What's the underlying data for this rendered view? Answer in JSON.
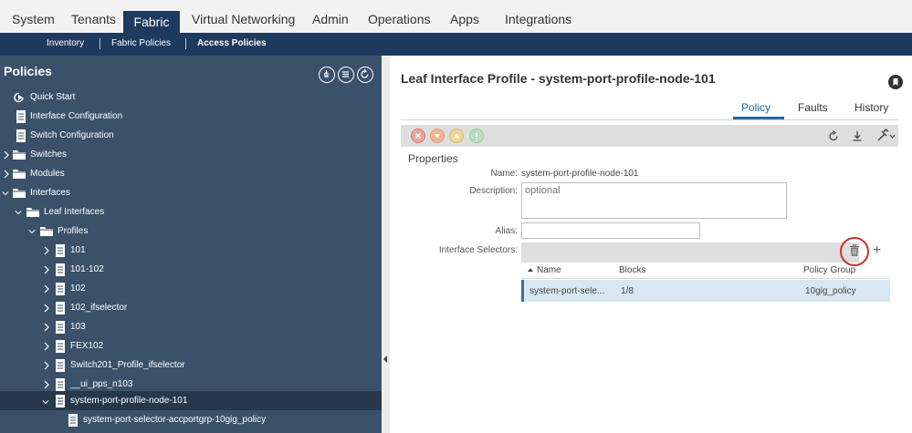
{
  "top_nav": {
    "tabs": [
      {
        "label": "System"
      },
      {
        "label": "Tenants"
      },
      {
        "label": "Fabric"
      },
      {
        "label": "Virtual Networking"
      },
      {
        "label": "Admin"
      },
      {
        "label": "Operations"
      },
      {
        "label": "Apps"
      },
      {
        "label": "Integrations"
      }
    ],
    "active_tab": "Fabric",
    "sub_items": [
      {
        "label": "Inventory"
      },
      {
        "label": "Fabric Policies"
      },
      {
        "label": "Access Policies"
      }
    ]
  },
  "sidebar": {
    "title": "Policies",
    "header_buttons": [
      "settings-icon",
      "list-icon",
      "refresh-icon"
    ],
    "tree": [
      {
        "label": "Quick Start",
        "icon": "quickstart-icon"
      },
      {
        "label": "Interface Configuration",
        "icon": "document-icon"
      },
      {
        "label": "Switch Configuration",
        "icon": "document-icon"
      },
      {
        "label": "Switches",
        "icon": "folder-icon"
      },
      {
        "label": "Modules",
        "icon": "folder-icon"
      },
      {
        "label": "Interfaces",
        "icon": "folder-icon"
      },
      {
        "label": "Leaf Interfaces",
        "icon": "folder-icon"
      },
      {
        "label": "Profiles",
        "icon": "folder-icon"
      },
      {
        "label": "101",
        "icon": "document-icon"
      },
      {
        "label": "101-102",
        "icon": "document-icon"
      },
      {
        "label": "102",
        "icon": "document-icon"
      },
      {
        "label": "102_ifselector",
        "icon": "document-icon"
      },
      {
        "label": "103",
        "icon": "document-icon"
      },
      {
        "label": "FEX102",
        "icon": "document-icon"
      },
      {
        "label": "Switch201_Profile_ifselector",
        "icon": "document-icon"
      },
      {
        "label": "__ui_pps_n103",
        "icon": "document-icon"
      },
      {
        "label": "system-port-profile-node-101",
        "icon": "document-icon"
      },
      {
        "label": "system-port-selector-accportgrp-10gig_policy",
        "icon": "document-icon"
      }
    ]
  },
  "main": {
    "title": "Leaf Interface Profile - system-port-profile-node-101",
    "tabs": [
      {
        "label": "Policy"
      },
      {
        "label": "Faults"
      },
      {
        "label": "History"
      }
    ],
    "active_tab": "Policy",
    "toolbar": {
      "fault_icons": [
        "critical-icon",
        "major-icon",
        "minor-icon",
        "warning-icon"
      ],
      "actions": [
        "refresh-icon",
        "download-icon",
        "tools-icon"
      ]
    },
    "properties": {
      "title": "Properties",
      "name_label": "Name:",
      "name_value": "system-port-profile-node-101",
      "description_label": "Description:",
      "description_placeholder": "optional",
      "alias_label": "Alias:",
      "alias_value": "",
      "selectors_label": "Interface Selectors:"
    },
    "selectors_table": {
      "columns": [
        "Name",
        "Blocks",
        "Policy Group"
      ],
      "rows": [
        {
          "name": "system-port-sele...",
          "blocks": "1/8",
          "policy_group": "10gig_policy"
        }
      ]
    }
  },
  "colors": {
    "nav_blue": "#1f3a5f",
    "sidebar_bg": "#3b5169",
    "sidebar_selected": "#27384c",
    "accent_blue": "#1f6aa5",
    "highlight_ring": "#d0302a",
    "row_selected": "#d9e7f2"
  }
}
